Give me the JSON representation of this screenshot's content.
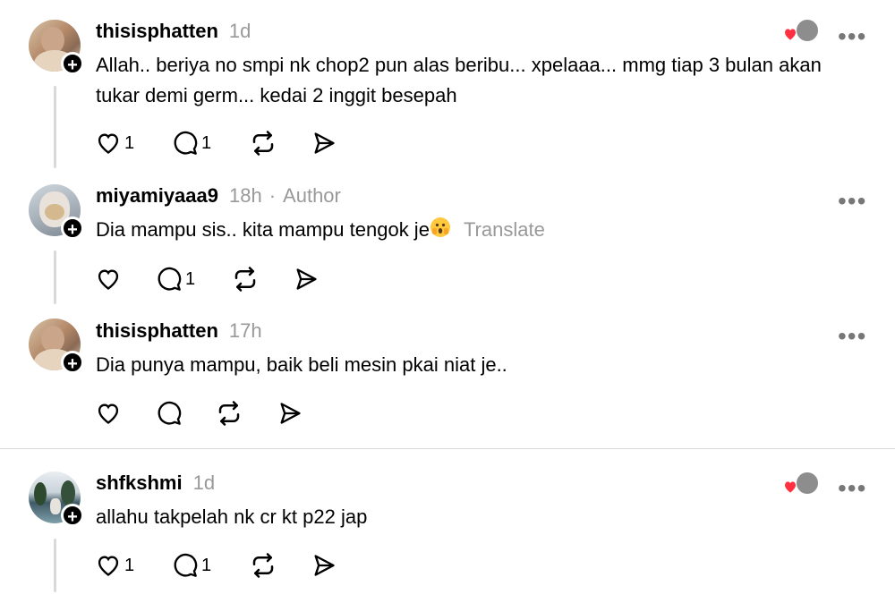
{
  "comments": [
    {
      "username": "thisisphatten",
      "time": "1d",
      "author_tag": "",
      "text": "Allah.. beriya no smpi nk chop2 pun alas beribu... xpelaaa... mmg tiap 3 bulan akan tukar demi germ... kedai 2 inggit besepah",
      "likes": "1",
      "replies": "1",
      "has_reactors": true
    },
    {
      "username": "miyamiyaaa9",
      "time": "18h",
      "author_tag": "Author",
      "text": "Dia mampu sis.. kita mampu tengok je",
      "translate_label": "Translate",
      "likes": "",
      "replies": "1",
      "has_reactors": false
    },
    {
      "username": "thisisphatten",
      "time": "17h",
      "author_tag": "",
      "text": "Dia punya mampu, baik beli mesin pkai niat je..",
      "likes": "",
      "replies": "",
      "has_reactors": false
    },
    {
      "username": "shfkshmi",
      "time": "1d",
      "author_tag": "",
      "text": "allahu takpelah nk cr kt p22 jap",
      "likes": "1",
      "replies": "1",
      "has_reactors": true
    }
  ],
  "icons": {
    "like": "heart-icon",
    "reply": "comment-bubble-icon",
    "repost": "repost-icon",
    "share": "send-icon",
    "more": "more-dots-icon",
    "follow": "plus-icon",
    "liked_heart_color": "#ff3040"
  }
}
